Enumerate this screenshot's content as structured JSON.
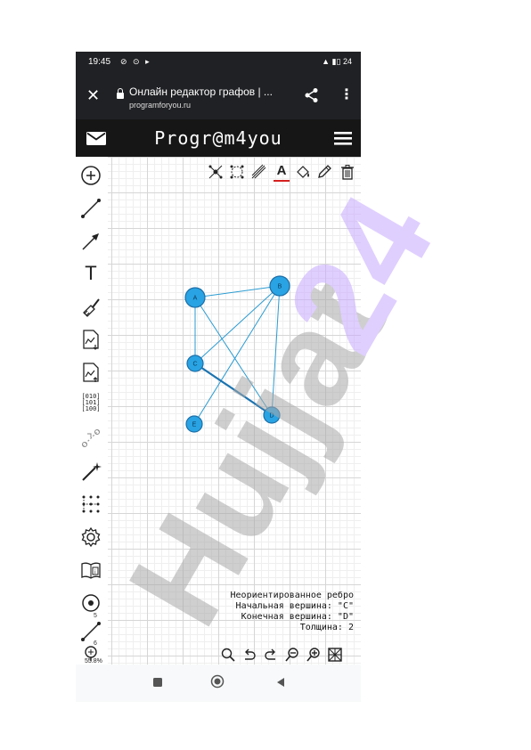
{
  "status_bar": {
    "time": "19:45",
    "battery": "24"
  },
  "browser": {
    "page_title": "Онлайн редактор графов | ...",
    "url": "programforyou.ru"
  },
  "site": {
    "logo": "Progr@m4you"
  },
  "graph": {
    "vertices": [
      {
        "label": "A"
      },
      {
        "label": "B"
      },
      {
        "label": "C"
      },
      {
        "label": "D"
      },
      {
        "label": "E"
      }
    ],
    "edges": [
      [
        "A",
        "B"
      ],
      [
        "A",
        "C"
      ],
      [
        "A",
        "D"
      ],
      [
        "B",
        "C"
      ],
      [
        "B",
        "D"
      ],
      [
        "B",
        "E"
      ],
      [
        "C",
        "D"
      ]
    ],
    "selected_edge": [
      "C",
      "D"
    ]
  },
  "edge_info": {
    "line1": "Неориентированное ребро",
    "line2": "Начальная вершина: \"C\"",
    "line3": "Конечная вершина: \"D\"",
    "line4": "Толщина: 2"
  },
  "tool_badges": {
    "add_vertex_count": "5",
    "add_edge_count": "6"
  },
  "zoom_level": "55.8%",
  "watermark": "Hujjat 24",
  "colors": {
    "vertex_fill": "#29a3e3",
    "vertex_stroke": "#1c6fa8",
    "edge": "#2b9bd1",
    "selected_edge": "#1a73b0",
    "watermark": "#a9a9a9",
    "watermark_accent": "#c6a8ff"
  }
}
